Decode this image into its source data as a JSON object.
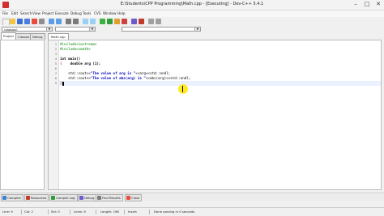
{
  "window": {
    "title": "E:\\Students\\CPP Programming\\Math.cpp - [Executing] - Dev-C++ 5.4.1",
    "controls": [
      "–",
      "□",
      "✕"
    ]
  },
  "menu": [
    "File",
    "Edit",
    "Search",
    "View",
    "Project",
    "Execute",
    "Debug",
    "Tools",
    "CVS",
    "Window",
    "Help"
  ],
  "toolbar": {
    "globals_combo": "(globals)",
    "compiler_combo": ""
  },
  "left_tabs": [
    "Project",
    "Classes",
    "Debug"
  ],
  "editor": {
    "file_tab": "Math.cpp",
    "line_numbers": [
      "1",
      "2",
      "3",
      "4",
      "5",
      "6",
      "7",
      "8",
      "9"
    ],
    "code": {
      "l1": "#include<iostream>",
      "l2": "#include<cmath>",
      "l4_kw": "int",
      "l4_rest": " main()",
      "l5": "{",
      "l5_kw": "double",
      "l5_rest": " arg (1);",
      "l7_a": "std::cout<<",
      "l7_str": "\"The value of arg is \"",
      "l7_b": "<<arg<<std::endl;",
      "l8_a": "std::cout<<",
      "l8_str": "\"The value of abs(arg) is \"",
      "l8_b": "<<abs(arg)<<std::endl;",
      "l9": "}"
    }
  },
  "bottom_tabs": [
    "Compiler",
    "Resources",
    "Compile Log",
    "Debug",
    "Find Results",
    "Close"
  ],
  "status": {
    "line": "Line: 9",
    "col": "Col: 2",
    "sel": "Sel: 0",
    "lines": "Lines: 9",
    "length": "Length: 196",
    "mode": "Insert",
    "msg": "Done parsing in 0 seconds"
  },
  "colors": {
    "accent_red": "#d32f2f",
    "include_green": "#008000",
    "string_blue": "#0000c0",
    "cursor_highlight": "#ffe600"
  }
}
